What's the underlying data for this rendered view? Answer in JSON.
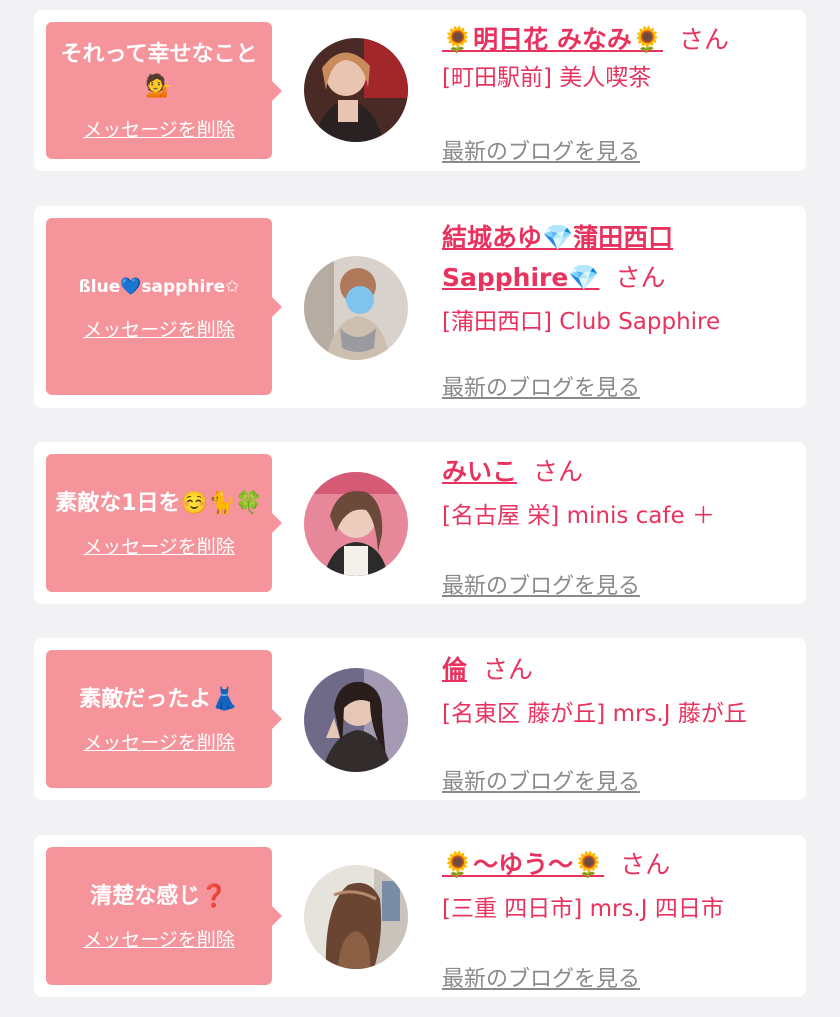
{
  "cards": [
    {
      "message": "それって幸せなこと💁",
      "delete_label": "メッセージを削除",
      "name": "🌻明日花 みなみ🌻",
      "honorific": "さん",
      "shop": "[町田駅前] 美人喫茶",
      "blog_label": "最新のブログを見る"
    },
    {
      "message": "ßlue💙sapphire✩",
      "delete_label": "メッセージを削除",
      "name": "結城あゆ💎蒲田西口Sapphire💎",
      "honorific": "さん",
      "shop": "[蒲田西口] Club Sapphire",
      "blog_label": "最新のブログを見る"
    },
    {
      "message": "素敵な1日を☺️🐈🍀",
      "delete_label": "メッセージを削除",
      "name": "みいこ",
      "honorific": "さん",
      "shop": "[名古屋 栄] minis cafe ＋",
      "blog_label": "最新のブログを見る"
    },
    {
      "message": "素敵だったよ👗",
      "delete_label": "メッセージを削除",
      "name": "倫",
      "honorific": "さん",
      "shop": "[名東区 藤が丘] mrs.J 藤が丘",
      "blog_label": "最新のブログを見る"
    },
    {
      "message": "清楚な感じ❓",
      "delete_label": "メッセージを削除",
      "name": "🌻〜ゆう〜🌻",
      "honorific": "さん",
      "shop": "[三重 四日市] mrs.J 四日市",
      "blog_label": "最新のブログを見る"
    }
  ],
  "colors": {
    "accent": "#e8335f",
    "bubble": "#f6949c",
    "link_gray": "#8a8a8a",
    "background": "#f2f2f4"
  },
  "icons": [
    "person-photo-avatar",
    "speech-bubble"
  ]
}
